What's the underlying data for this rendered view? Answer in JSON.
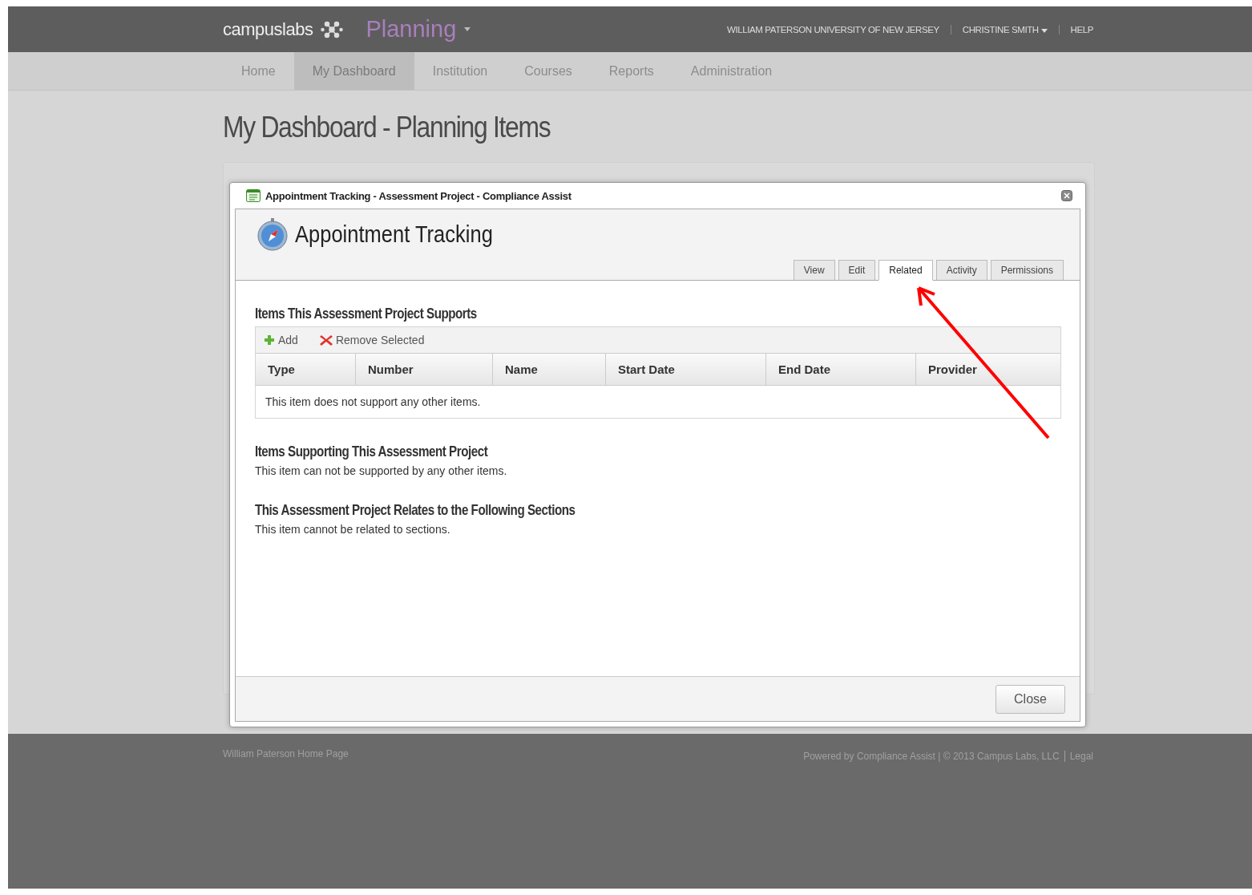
{
  "header": {
    "brand": "campuslabs",
    "product": "Planning",
    "institution": "WILLIAM PATERSON UNIVERSITY OF NEW JERSEY",
    "user": "CHRISTINE SMITH",
    "help": "HELP"
  },
  "nav": [
    {
      "label": "Home",
      "selected": false
    },
    {
      "label": "My Dashboard",
      "selected": true
    },
    {
      "label": "Institution",
      "selected": false
    },
    {
      "label": "Courses",
      "selected": false
    },
    {
      "label": "Reports",
      "selected": false
    },
    {
      "label": "Administration",
      "selected": false
    }
  ],
  "page_title": "My Dashboard - Planning Items",
  "dialog": {
    "title": "Appointment Tracking - Assessment Project - Compliance Assist",
    "heading": "Appointment Tracking",
    "tabs": [
      {
        "label": "View",
        "selected": false
      },
      {
        "label": "Edit",
        "selected": false
      },
      {
        "label": "Related",
        "selected": true
      },
      {
        "label": "Activity",
        "selected": false
      },
      {
        "label": "Permissions",
        "selected": false
      }
    ],
    "supports": {
      "heading": "Items This Assessment Project Supports",
      "toolbar": [
        {
          "label": "Add",
          "kind": "add"
        },
        {
          "label": "Remove Selected",
          "kind": "remove"
        }
      ],
      "columns": [
        "Type",
        "Number",
        "Name",
        "Start Date",
        "End Date",
        "Provider"
      ],
      "empty_message": "This item does not support any other items."
    },
    "sections": [
      {
        "heading": "Items Supporting This Assessment Project",
        "text": "This item can not be supported by any other items."
      },
      {
        "heading": "This Assessment Project Relates to the Following Sections",
        "text": "This item cannot be related to sections."
      }
    ],
    "close_button": "Close"
  },
  "footer": {
    "home_link": "William Paterson Home Page",
    "credit": "Powered by Compliance Assist | © 2013 Campus Labs, LLC",
    "legal": "Legal"
  }
}
